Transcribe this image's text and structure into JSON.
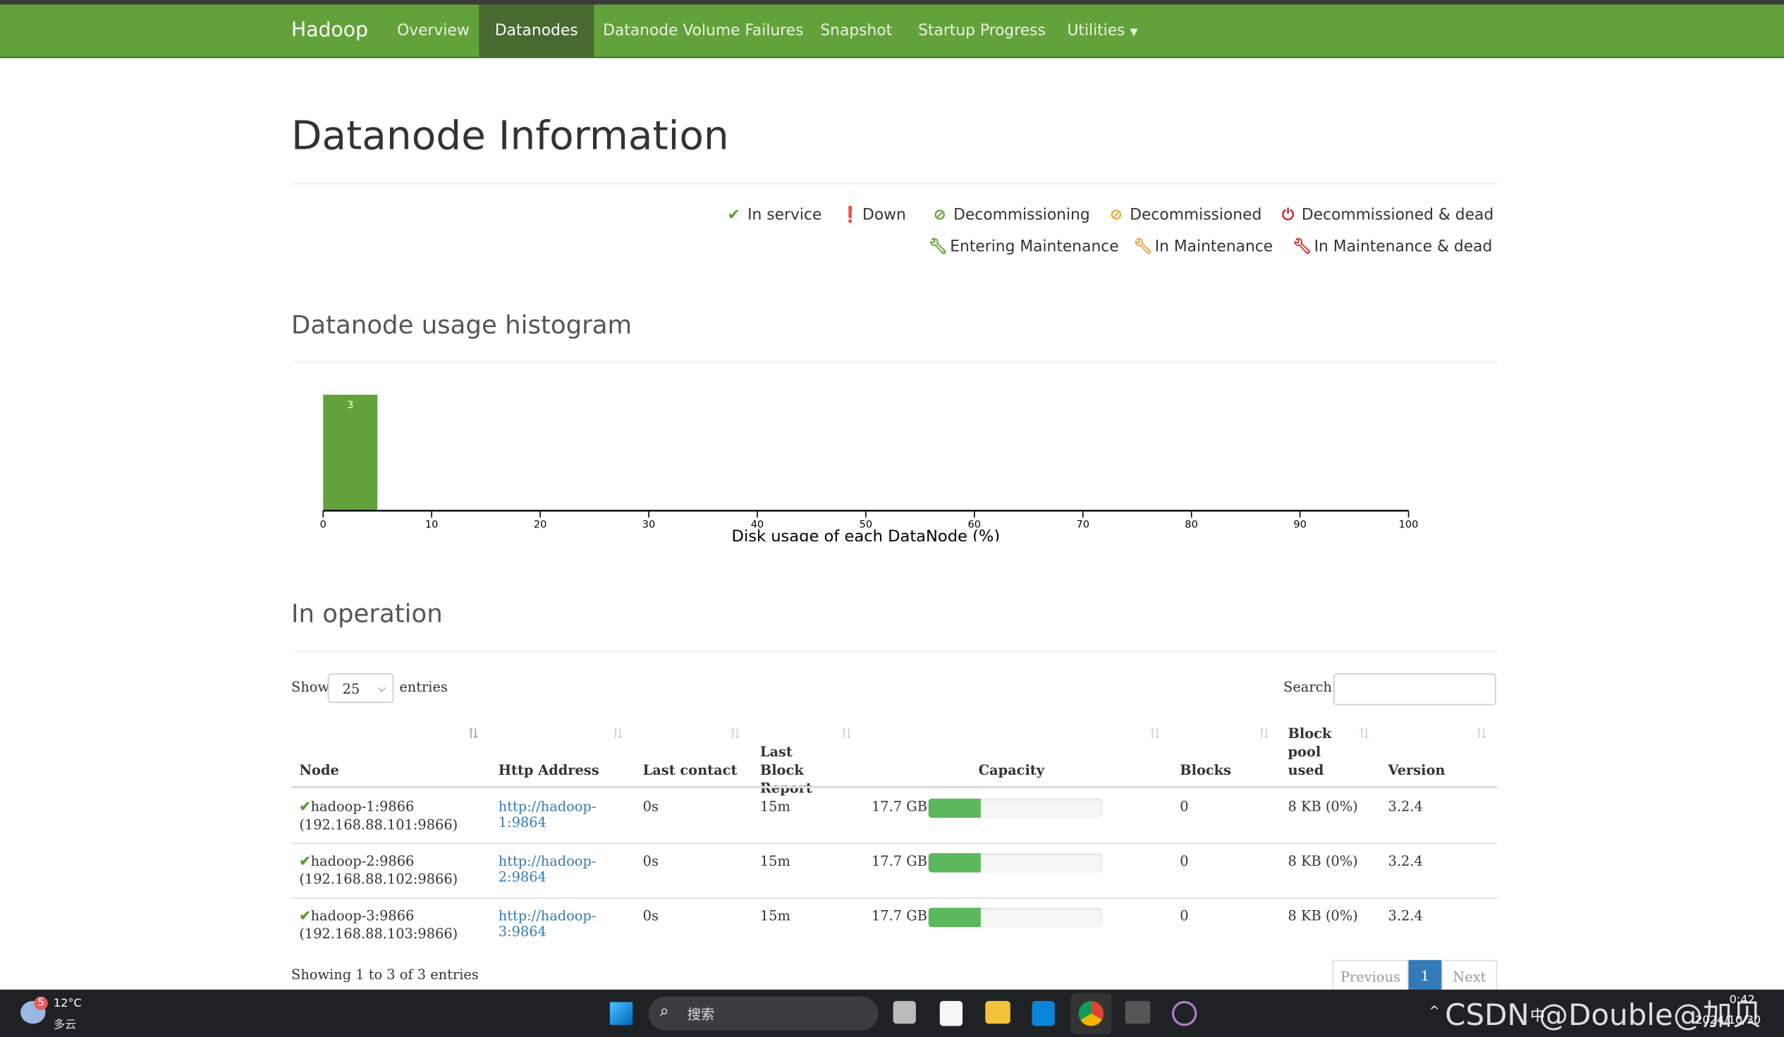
{
  "nav": {
    "brand": "Hadoop",
    "items": [
      "Overview",
      "Datanodes",
      "Datanode Volume Failures",
      "Snapshot",
      "Startup Progress",
      "Utilities"
    ],
    "active": "Datanodes",
    "bg_color": "#63a13a"
  },
  "page_title": "Datanode Information",
  "legend": [
    {
      "icon": "check-icon",
      "label": "In service",
      "color": "#5a9e2f"
    },
    {
      "icon": "exclamation-circle-icon",
      "label": "Down",
      "color": "#c9302c"
    },
    {
      "icon": "ban-icon",
      "label": "Decommissioning",
      "color": "#5a9e2f"
    },
    {
      "icon": "ban-icon",
      "label": "Decommissioned",
      "color": "#eea236"
    },
    {
      "icon": "power-icon",
      "label": "Decommissioned & dead",
      "color": "#c9302c"
    },
    {
      "icon": "wrench-icon",
      "label": "Entering Maintenance",
      "color": "#5a9e2f"
    },
    {
      "icon": "wrench-icon",
      "label": "In Maintenance",
      "color": "#eea236"
    },
    {
      "icon": "wrench-icon",
      "label": "In Maintenance & dead",
      "color": "#c9302c"
    }
  ],
  "histogram_title": "Datanode usage histogram",
  "chart_data": {
    "type": "bar",
    "bins": [
      {
        "from": 0,
        "to": 5,
        "count": 3
      }
    ],
    "xlabel": "Disk usage of each DataNode (%)",
    "xlim": [
      0,
      100
    ],
    "xticks": [
      0,
      10,
      20,
      30,
      40,
      50,
      60,
      70,
      80,
      90,
      100
    ],
    "bar_color": "#63a13a",
    "grid": false
  },
  "operation_title": "In operation",
  "table_controls": {
    "show_label": "Show",
    "page_size": "25",
    "entries_label": "entries",
    "search_label": "Search:",
    "search_value": ""
  },
  "columns": [
    "Node",
    "Http Address",
    "Last contact",
    "Last Block Report",
    "Capacity",
    "Blocks",
    "Block pool used",
    "Version"
  ],
  "rows": [
    {
      "node": "hadoop-1:9866",
      "ip": "(192.168.88.101:9866)",
      "http1": "http://hadoop-",
      "http2": "1:9864",
      "last_contact": "0s",
      "last_block": "15m",
      "capacity": "17.7 GB",
      "capacity_used_pct": 30,
      "blocks": "0",
      "pool": "8 KB (0%)",
      "version": "3.2.4"
    },
    {
      "node": "hadoop-2:9866",
      "ip": "(192.168.88.102:9866)",
      "http1": "http://hadoop-",
      "http2": "2:9864",
      "last_contact": "0s",
      "last_block": "15m",
      "capacity": "17.7 GB",
      "capacity_used_pct": 30,
      "blocks": "0",
      "pool": "8 KB (0%)",
      "version": "3.2.4"
    },
    {
      "node": "hadoop-3:9866",
      "ip": "(192.168.88.103:9866)",
      "http1": "http://hadoop-",
      "http2": "3:9864",
      "last_contact": "0s",
      "last_block": "15m",
      "capacity": "17.7 GB",
      "capacity_used_pct": 30,
      "blocks": "0",
      "pool": "8 KB (0%)",
      "version": "3.2.4"
    }
  ],
  "footer": {
    "info": "Showing 1 to 3 of 3 entries",
    "prev": "Previous",
    "page": "1",
    "next": "Next"
  },
  "taskbar": {
    "weather_temp": "12°C",
    "weather_desc": "多云",
    "weather_badge": "5",
    "search_placeholder": "搜索",
    "date": "2024/10/30",
    "time": "0:42",
    "watermark": "CSDN @Double@加贝",
    "ime": "中"
  }
}
